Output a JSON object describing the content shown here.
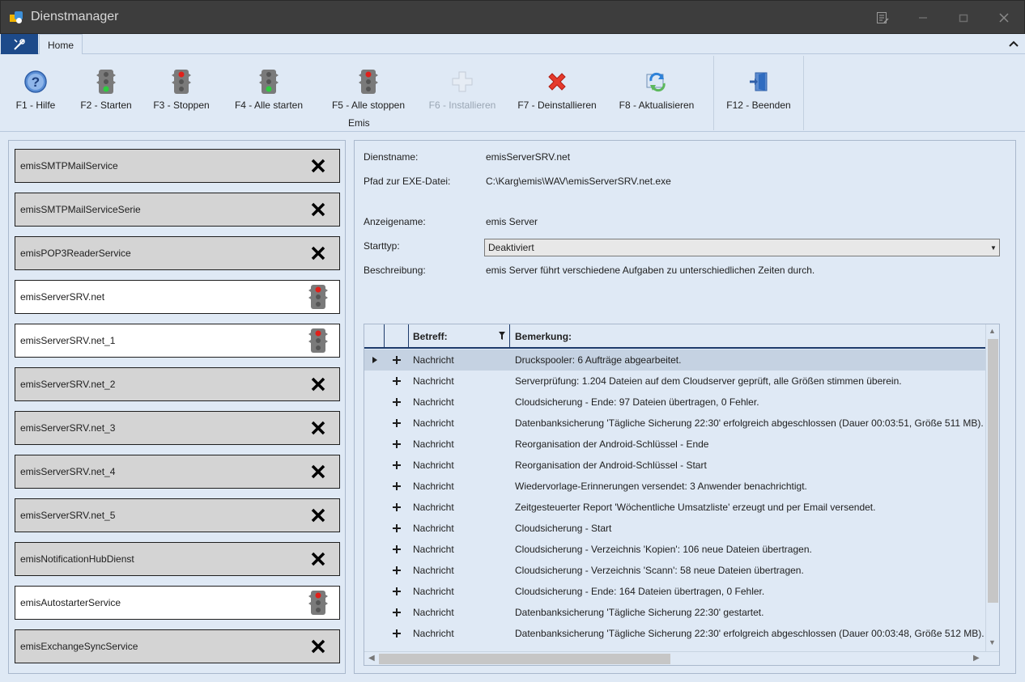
{
  "window": {
    "title": "Dienstmanager"
  },
  "tabs": {
    "home": "Home"
  },
  "ribbon": {
    "group_label": "Emis",
    "buttons": [
      {
        "label": "F1 - Hilfe",
        "icon": "help-icon"
      },
      {
        "label": "F2 - Starten",
        "icon": "traffic-light-green-icon"
      },
      {
        "label": "F3 - Stoppen",
        "icon": "traffic-light-red-icon"
      },
      {
        "label": "F4 - Alle starten",
        "icon": "traffic-light-green-icon"
      },
      {
        "label": "F5 - Alle stoppen",
        "icon": "traffic-light-red-icon"
      },
      {
        "label": "F6 - Installieren",
        "icon": "plus-icon",
        "disabled": true
      },
      {
        "label": "F7 - Deinstallieren",
        "icon": "red-x-icon"
      },
      {
        "label": "F8 - Aktualisieren",
        "icon": "refresh-icon"
      },
      {
        "label": "F12 - Beenden",
        "icon": "exit-door-icon"
      }
    ]
  },
  "services": [
    {
      "name": "emisSMTPMailService",
      "status": "not-installed"
    },
    {
      "name": "emisSMTPMailServiceSerie",
      "status": "not-installed"
    },
    {
      "name": "emisPOP3ReaderService",
      "status": "not-installed"
    },
    {
      "name": "emisServerSRV.net",
      "status": "stopped"
    },
    {
      "name": "emisServerSRV.net_1",
      "status": "stopped"
    },
    {
      "name": "emisServerSRV.net_2",
      "status": "not-installed"
    },
    {
      "name": "emisServerSRV.net_3",
      "status": "not-installed"
    },
    {
      "name": "emisServerSRV.net_4",
      "status": "not-installed"
    },
    {
      "name": "emisServerSRV.net_5",
      "status": "not-installed"
    },
    {
      "name": "emisNotificationHubDienst",
      "status": "not-installed"
    },
    {
      "name": "emisAutostarterService",
      "status": "stopped"
    },
    {
      "name": "emisExchangeSyncService",
      "status": "not-installed"
    }
  ],
  "details": {
    "dienstname_label": "Dienstname:",
    "dienstname_value": "emisServerSRV.net",
    "pfad_label": "Pfad zur EXE-Datei:",
    "pfad_value": "C:\\Karg\\emis\\WAV\\emisServerSRV.net.exe",
    "anzeigename_label": "Anzeigename:",
    "anzeigename_value": "emis Server",
    "starttyp_label": "Starttyp:",
    "starttyp_value": "Deaktiviert",
    "beschreibung_label": "Beschreibung:",
    "beschreibung_value": "emis Server führt verschiedene Aufgaben zu unterschiedlichen Zeiten durch."
  },
  "grid": {
    "columns": {
      "betreff": "Betreff:",
      "bemerkung": "Bemerkung:"
    },
    "rows": [
      {
        "betreff": "Nachricht",
        "bemerkung": "Druckspooler: 6 Aufträge abgearbeitet."
      },
      {
        "betreff": "Nachricht",
        "bemerkung": "Serverprüfung: 1.204 Dateien auf dem Cloudserver geprüft, alle Größen stimmen überein."
      },
      {
        "betreff": "Nachricht",
        "bemerkung": "Cloudsicherung - Ende: 97 Dateien übertragen, 0 Fehler."
      },
      {
        "betreff": "Nachricht",
        "bemerkung": "Datenbanksicherung 'Tägliche Sicherung 22:30' erfolgreich abgeschlossen (Dauer 00:03:51, Größe 511 MB)."
      },
      {
        "betreff": "Nachricht",
        "bemerkung": "Reorganisation der Android-Schlüssel - Ende"
      },
      {
        "betreff": "Nachricht",
        "bemerkung": "Reorganisation der Android-Schlüssel - Start"
      },
      {
        "betreff": "Nachricht",
        "bemerkung": "Wiedervorlage-Erinnerungen versendet: 3 Anwender benachrichtigt."
      },
      {
        "betreff": "Nachricht",
        "bemerkung": "Zeitgesteuerter Report 'Wöchentliche Umsatzliste' erzeugt und per Email versendet."
      },
      {
        "betreff": "Nachricht",
        "bemerkung": "Cloudsicherung - Start"
      },
      {
        "betreff": "Nachricht",
        "bemerkung": "Cloudsicherung - Verzeichnis 'Kopien': 106 neue Dateien übertragen."
      },
      {
        "betreff": "Nachricht",
        "bemerkung": "Cloudsicherung - Verzeichnis 'Scann': 58 neue Dateien übertragen."
      },
      {
        "betreff": "Nachricht",
        "bemerkung": "Cloudsicherung - Ende: 164 Dateien übertragen, 0 Fehler."
      },
      {
        "betreff": "Nachricht",
        "bemerkung": "Datenbanksicherung 'Tägliche Sicherung 22:30' gestartet."
      },
      {
        "betreff": "Nachricht",
        "bemerkung": "Datenbanksicherung 'Tägliche Sicherung 22:30' erfolgreich abgeschlossen (Dauer 00:03:48, Größe 512 MB)."
      }
    ]
  }
}
